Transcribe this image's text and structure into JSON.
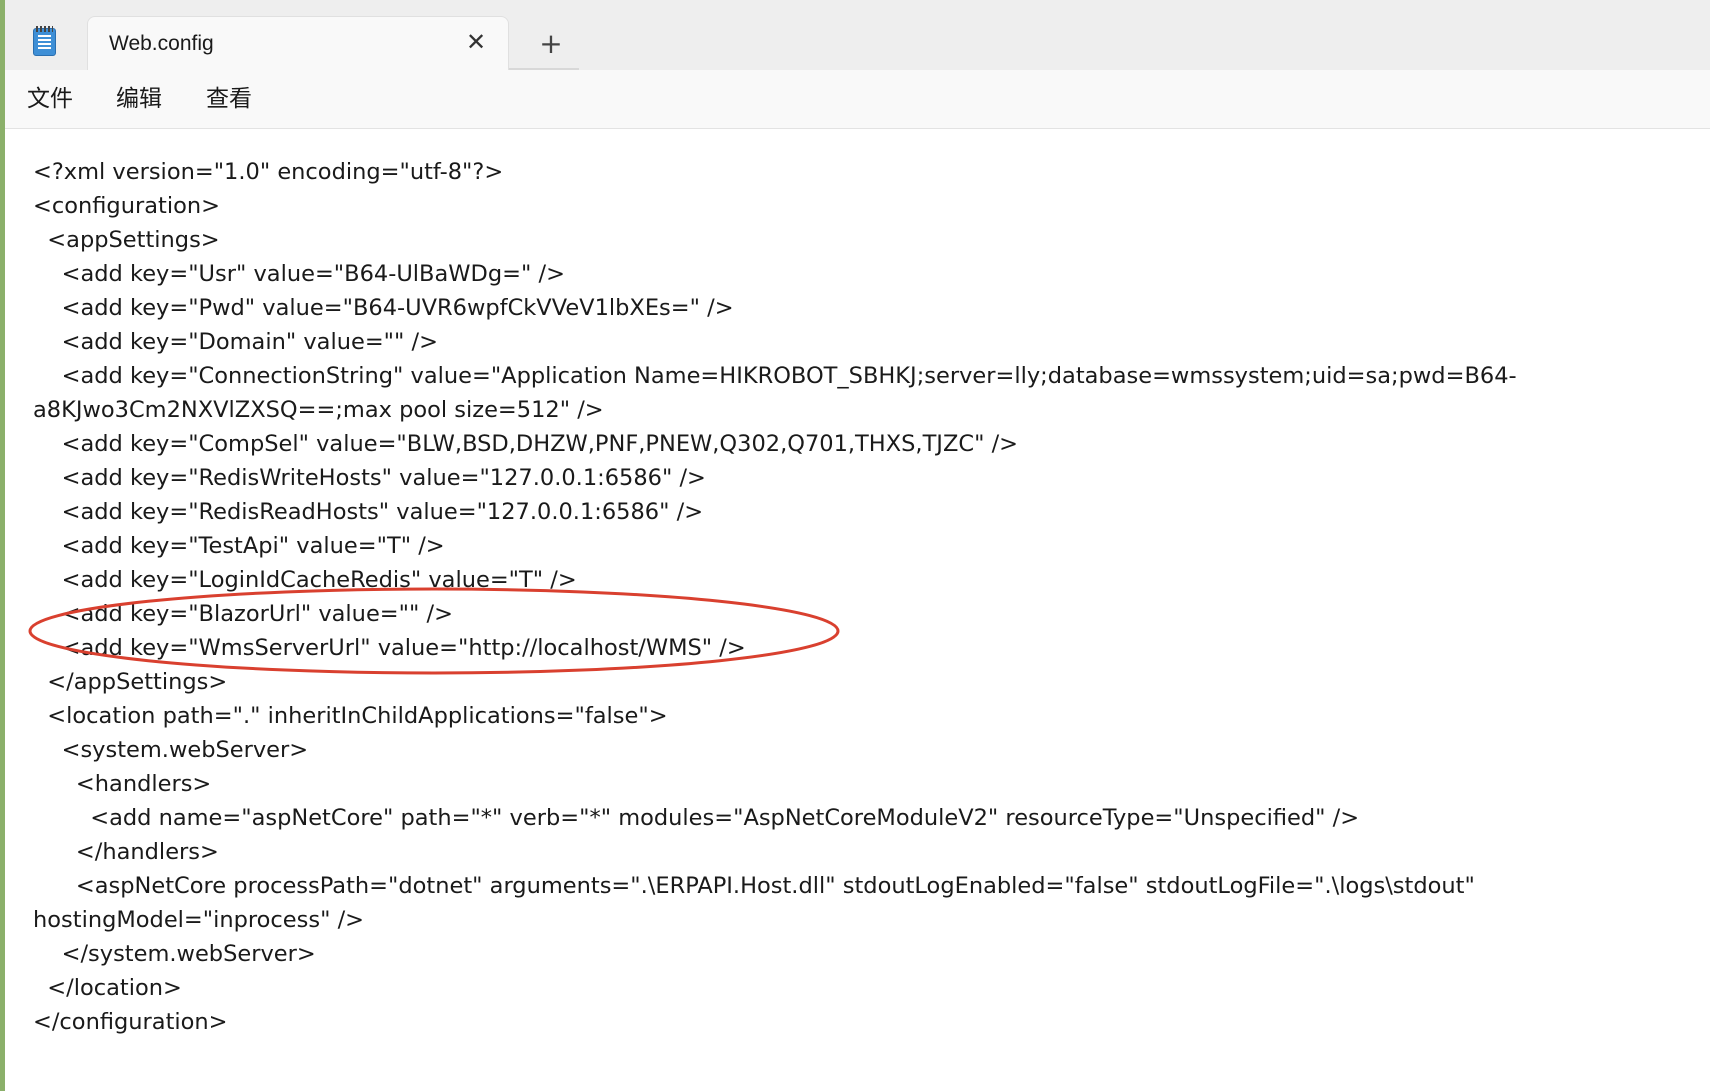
{
  "tab": {
    "title": "Web.config",
    "close_symbol": "✕",
    "new_tab_symbol": "+"
  },
  "menu": {
    "items": [
      "文件",
      "编辑",
      "查看"
    ]
  },
  "editor": {
    "lines": [
      "<?xml version=\"1.0\" encoding=\"utf-8\"?>",
      "<configuration>",
      "  <appSettings>",
      "    <add key=\"Usr\" value=\"B64-UlBaWDg=\" />",
      "    <add key=\"Pwd\" value=\"B64-UVR6wpfCkVVeV1lbXEs=\" />",
      "    <add key=\"Domain\" value=\"\" />",
      "    <add key=\"ConnectionString\" value=\"Application Name=HIKROBOT_SBHKJ;server=lly;database=wmssystem;uid=sa;pwd=B64-",
      "a8KJwo3Cm2NXVlZXSQ==;max pool size=512\" />",
      "    <add key=\"CompSel\" value=\"BLW,BSD,DHZW,PNF,PNEW,Q302,Q701,THXS,TJZC\" />",
      "    <add key=\"RedisWriteHosts\" value=\"127.0.0.1:6586\" />",
      "    <add key=\"RedisReadHosts\" value=\"127.0.0.1:6586\" />",
      "    <add key=\"TestApi\" value=\"T\" />",
      "    <add key=\"LoginIdCacheRedis\" value=\"T\" />",
      "    <add key=\"BlazorUrl\" value=\"\" />",
      "    <add key=\"WmsServerUrl\" value=\"http://localhost/WMS\" />",
      "  </appSettings>",
      "  <location path=\".\" inheritInChildApplications=\"false\">",
      "    <system.webServer>",
      "      <handlers>",
      "        <add name=\"aspNetCore\" path=\"*\" verb=\"*\" modules=\"AspNetCoreModuleV2\" resourceType=\"Unspecified\" />",
      "      </handlers>",
      "      <aspNetCore processPath=\"dotnet\" arguments=\".\\ERPAPI.Host.dll\" stdoutLogEnabled=\"false\" stdoutLogFile=\".\\logs\\stdout\"",
      "hostingModel=\"inprocess\" />",
      "    </system.webServer>",
      "  </location>",
      "</configuration>"
    ]
  },
  "annotation": {
    "color": "#d9402f"
  }
}
